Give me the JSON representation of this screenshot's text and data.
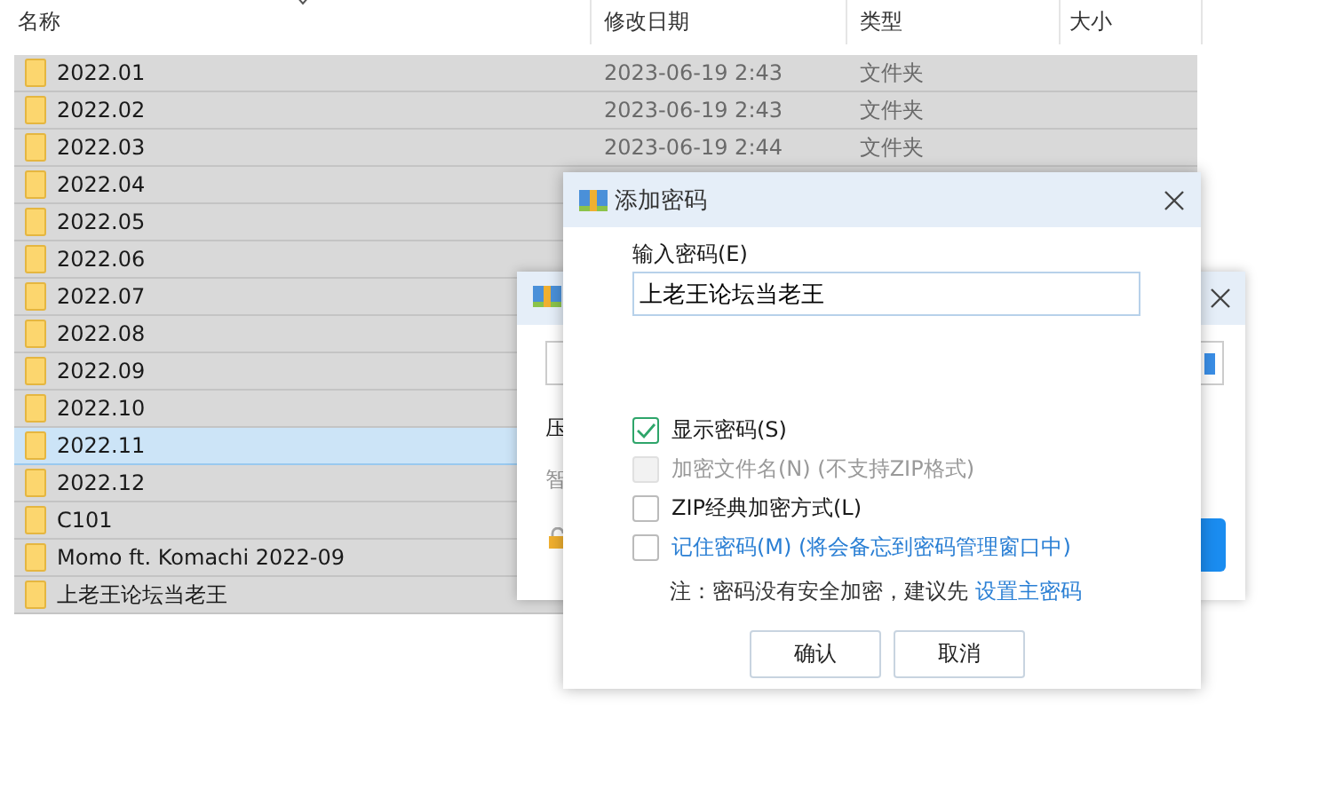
{
  "table": {
    "columns": [
      "名称",
      "修改日期",
      "类型",
      "大小"
    ],
    "rows": [
      {
        "name": "2022.01",
        "date": "2023-06-19 2:43",
        "type": "文件夹",
        "selected": false
      },
      {
        "name": "2022.02",
        "date": "2023-06-19 2:43",
        "type": "文件夹",
        "selected": false
      },
      {
        "name": "2022.03",
        "date": "2023-06-19 2:44",
        "type": "文件夹",
        "selected": false
      },
      {
        "name": "2022.04",
        "selected": false
      },
      {
        "name": "2022.05",
        "selected": false
      },
      {
        "name": "2022.06",
        "selected": false
      },
      {
        "name": "2022.07",
        "selected": false
      },
      {
        "name": "2022.08",
        "selected": false
      },
      {
        "name": "2022.09",
        "selected": false
      },
      {
        "name": "2022.10",
        "selected": false
      },
      {
        "name": "2022.11",
        "selected": true
      },
      {
        "name": "2022.12",
        "selected": false
      },
      {
        "name": "C101",
        "selected": false
      },
      {
        "name": "Momo ft. Komachi 2022-09",
        "selected": false
      },
      {
        "name": "上老王论坛当老王",
        "selected": false
      }
    ]
  },
  "back_dialog": {
    "texts": [
      "压",
      "智"
    ]
  },
  "dialog": {
    "title": "添加密码",
    "field_label": "输入密码(E)",
    "password": "上老王论坛当老王",
    "options": [
      {
        "kind": "checkbox",
        "label": "显示密码(S)",
        "checked": true,
        "disabled": false
      },
      {
        "kind": "checkbox",
        "label": "加密文件名(N) (不支持ZIP格式)",
        "checked": false,
        "disabled": true
      },
      {
        "kind": "checkbox",
        "label": "ZIP经典加密方式(L)",
        "checked": false,
        "disabled": false
      },
      {
        "kind": "link",
        "label": "记住密码(M) (将会备忘到密码管理窗口中)",
        "checked": false,
        "disabled": false
      }
    ],
    "note": "注：密码没有安全加密，建议先",
    "note_link": "设置主密码",
    "buttons": [
      "确认",
      "取消"
    ]
  }
}
